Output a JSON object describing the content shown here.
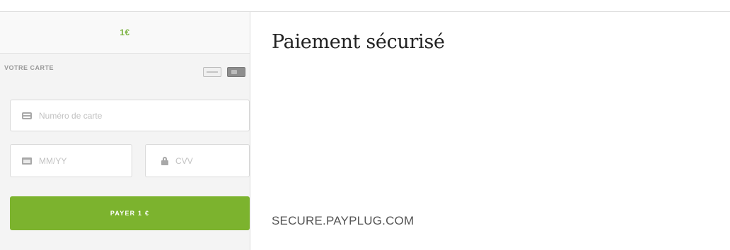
{
  "payment_widget": {
    "amount": "1€",
    "card_section_label": "VOTRE CARTE",
    "card_logos": [
      "generic-card-icon",
      "card-chip-icon"
    ],
    "card_number": {
      "placeholder": "Numéro de carte",
      "value": ""
    },
    "expiry": {
      "placeholder": "MM/YY",
      "value": ""
    },
    "cvv": {
      "placeholder": "CVV",
      "value": ""
    },
    "pay_button_label": "PAYER 1 €"
  },
  "page": {
    "title": "Paiement sécurisé",
    "domain": "SECURE.PAYPLUG.COM"
  },
  "colors": {
    "accent_green": "#7cb32e",
    "amount_green": "#7cb342",
    "panel_bg": "#f4f4f4"
  }
}
